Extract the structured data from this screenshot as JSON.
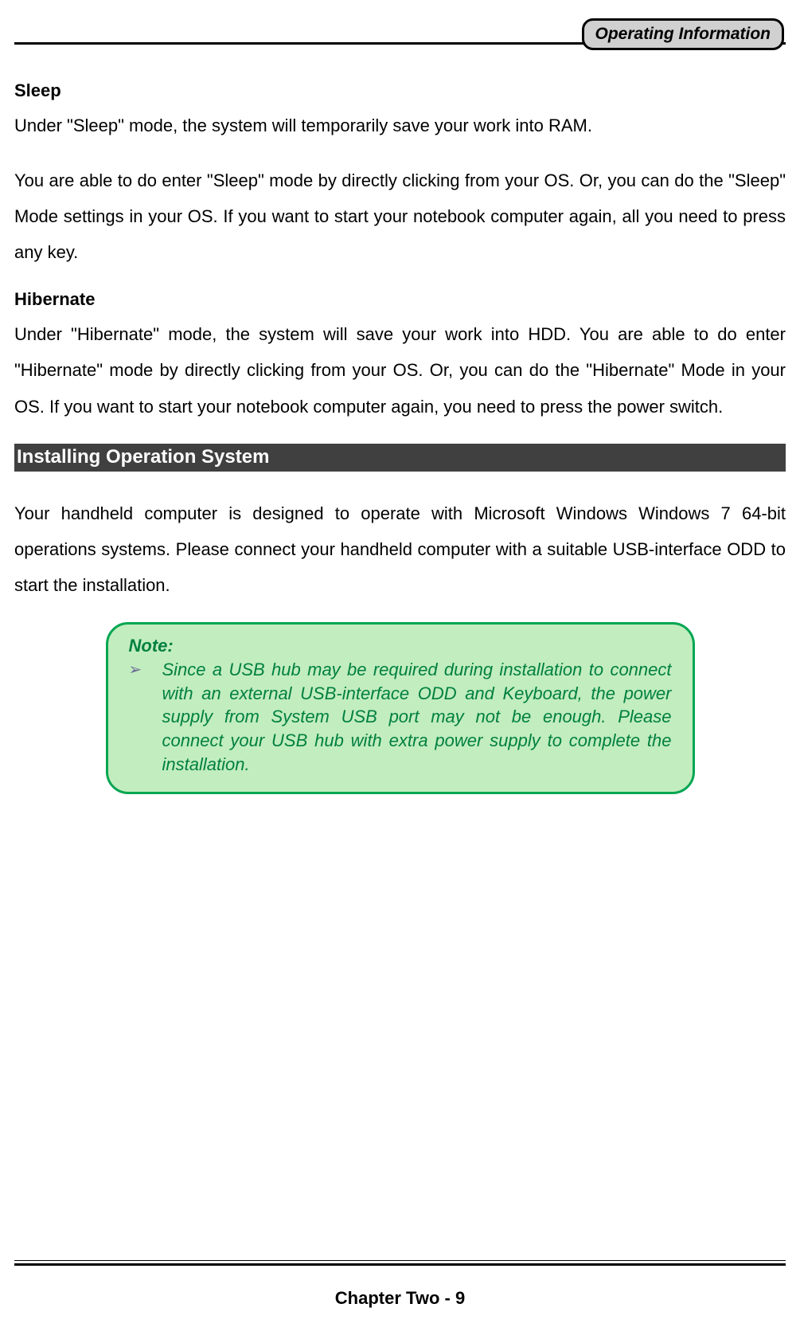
{
  "header": {
    "badge": "Operating Information"
  },
  "sections": {
    "sleep": {
      "heading": "Sleep",
      "p1": "Under \"Sleep\" mode, the system will temporarily save your work into RAM.",
      "p2": "You are able to do enter \"Sleep\" mode by directly clicking from your OS. Or, you can do the \"Sleep\" Mode settings in your OS. If you want to start your notebook computer again, all you need to press any key."
    },
    "hibernate": {
      "heading": "Hibernate",
      "p1": "Under \"Hibernate\" mode, the system will save your work into HDD. You are able to do enter \"Hibernate\" mode by directly clicking from your OS. Or, you can do the \"Hibernate\" Mode in your OS. If you want to start your notebook computer again, you need to press the power switch."
    },
    "installing": {
      "banner": "Installing Operation System",
      "p1": "Your handheld computer is designed to operate with Microsoft Windows Windows 7 64-bit operations systems. Please connect your handheld computer with a suitable USB-interface ODD to start the installation."
    }
  },
  "note": {
    "label": "Note:",
    "bullet": "➢",
    "text": "Since a USB hub may be required during installation to connect with an external USB-interface ODD and Keyboard, the power supply from System USB port may not be enough. Please connect your USB hub with extra power supply to complete the installation."
  },
  "footer": {
    "text": "Chapter Two - 9"
  }
}
